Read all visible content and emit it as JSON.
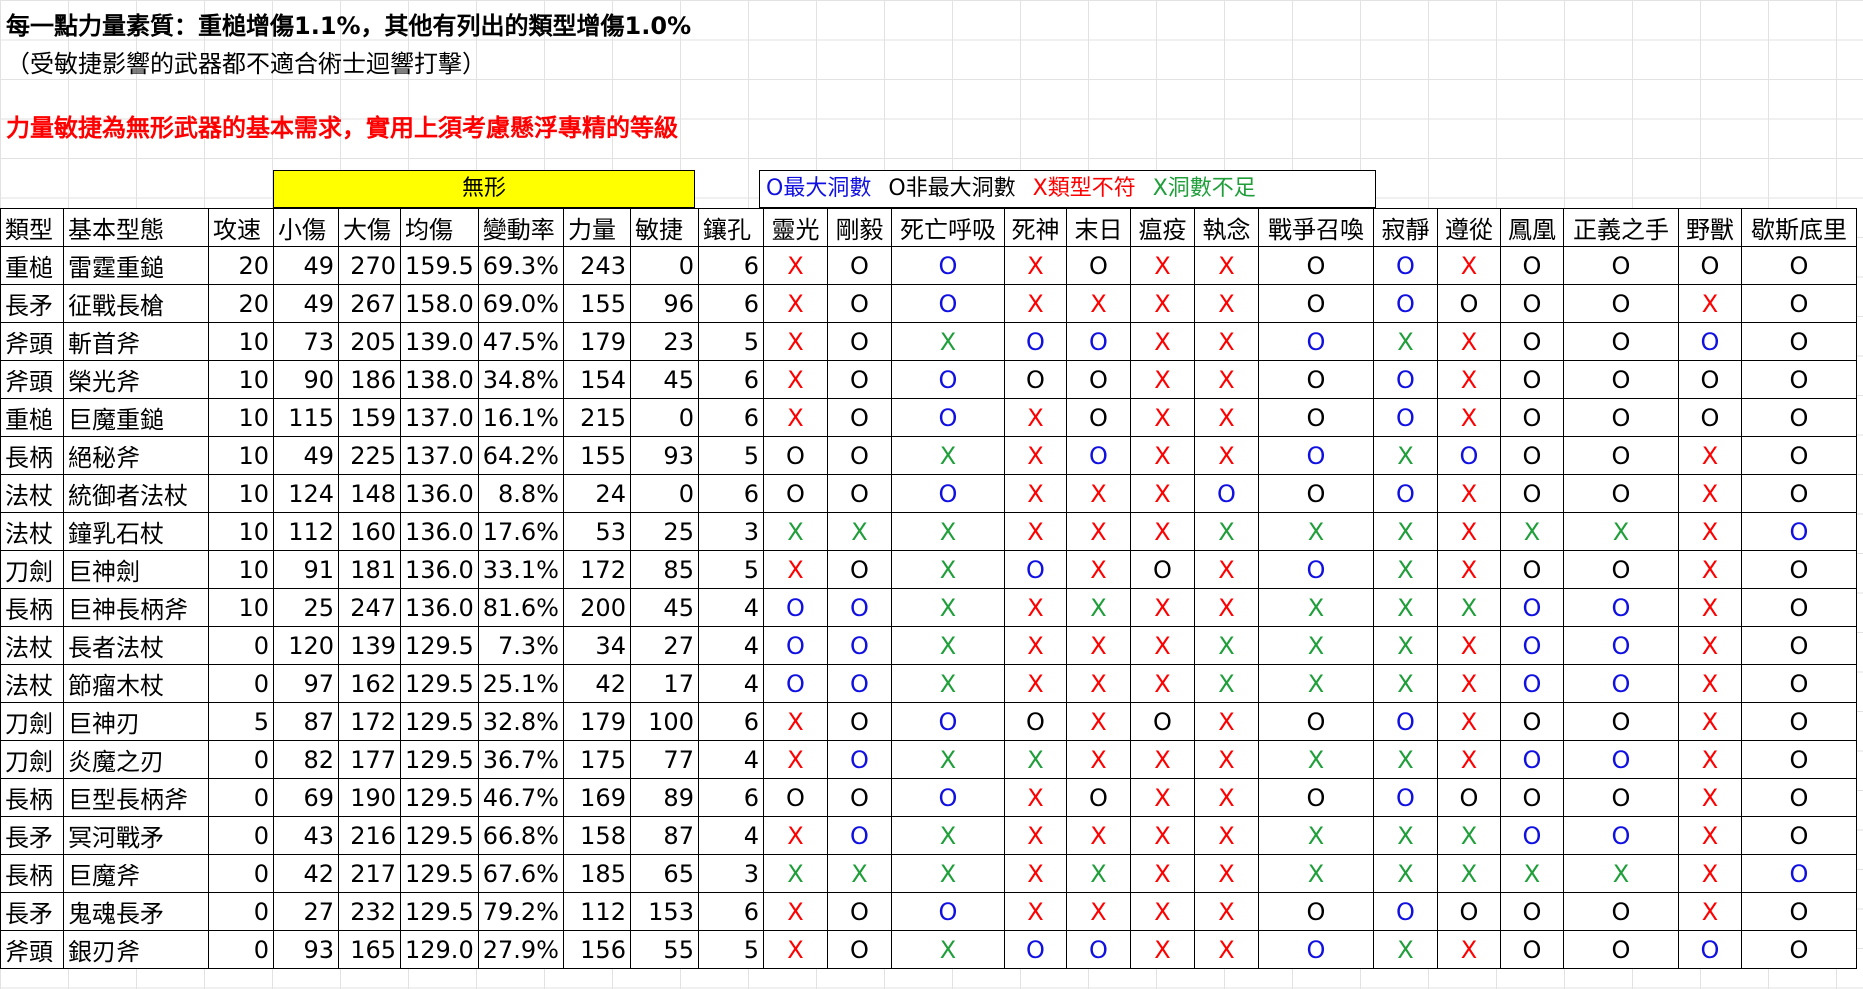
{
  "notes": {
    "line1": "每一點力量素質：重槌增傷1.1%，其他有列出的類型增傷1.0%",
    "line2": "（受敏捷影響的武器都不適合術士迴響打擊）",
    "line3": "力量敏捷為無形武器的基本需求，實用上須考慮懸浮專精的等級"
  },
  "group_header": "無形",
  "legend": {
    "max_holes": "O最大洞數",
    "not_max_holes": "O非最大洞數",
    "type_mismatch": "X類型不符",
    "not_enough_holes": "X洞數不足"
  },
  "colors": {
    "O": "#1010e0",
    "o": "#000000",
    "X": "#ff0000",
    "x": "#1f9e3a",
    "highlight": "#ffff00"
  },
  "columns": [
    "類型",
    "基本型態",
    "攻速",
    "小傷",
    "大傷",
    "均傷",
    "變動率",
    "力量",
    "敏捷",
    "鑲孔",
    "靈光",
    "剛毅",
    "死亡呼吸",
    "死神",
    "末日",
    "瘟疫",
    "執念",
    "戰爭召喚",
    "寂靜",
    "遵從",
    "鳳凰",
    "正義之手",
    "野獸",
    "歇斯底里"
  ],
  "rows": [
    {
      "type": "重槌",
      "name": "雷霆重鎚",
      "speed": "20",
      "min": "49",
      "max": "270",
      "avg": "159.5",
      "var": "69.3%",
      "str": "243",
      "dex": "0",
      "sockets": "6",
      "marks": [
        "X",
        "o",
        "O",
        "X",
        "o",
        "X",
        "X",
        "o",
        "O",
        "X",
        "o",
        "o",
        "o",
        "o"
      ]
    },
    {
      "type": "長矛",
      "name": "征戰長槍",
      "speed": "20",
      "min": "49",
      "max": "267",
      "avg": "158.0",
      "var": "69.0%",
      "str": "155",
      "dex": "96",
      "sockets": "6",
      "marks": [
        "X",
        "o",
        "O",
        "X",
        "X",
        "X",
        "X",
        "o",
        "O",
        "o",
        "o",
        "o",
        "X",
        "o"
      ]
    },
    {
      "type": "斧頭",
      "name": "斬首斧",
      "speed": "10",
      "min": "73",
      "max": "205",
      "avg": "139.0",
      "var": "47.5%",
      "str": "179",
      "dex": "23",
      "sockets": "5",
      "marks": [
        "X",
        "o",
        "x",
        "O",
        "O",
        "X",
        "X",
        "O",
        "x",
        "X",
        "o",
        "o",
        "O",
        "o"
      ]
    },
    {
      "type": "斧頭",
      "name": "榮光斧",
      "speed": "10",
      "min": "90",
      "max": "186",
      "avg": "138.0",
      "var": "34.8%",
      "str": "154",
      "dex": "45",
      "sockets": "6",
      "marks": [
        "X",
        "o",
        "O",
        "o",
        "o",
        "X",
        "X",
        "o",
        "O",
        "X",
        "o",
        "o",
        "o",
        "o"
      ]
    },
    {
      "type": "重槌",
      "name": "巨魔重鎚",
      "speed": "10",
      "min": "115",
      "max": "159",
      "avg": "137.0",
      "var": "16.1%",
      "str": "215",
      "dex": "0",
      "sockets": "6",
      "marks": [
        "X",
        "o",
        "O",
        "X",
        "o",
        "X",
        "X",
        "o",
        "O",
        "X",
        "o",
        "o",
        "o",
        "o"
      ]
    },
    {
      "type": "長柄",
      "name": "絕秘斧",
      "speed": "10",
      "min": "49",
      "max": "225",
      "avg": "137.0",
      "var": "64.2%",
      "str": "155",
      "dex": "93",
      "sockets": "5",
      "marks": [
        "o",
        "o",
        "x",
        "X",
        "O",
        "X",
        "X",
        "O",
        "x",
        "O",
        "o",
        "o",
        "X",
        "o"
      ]
    },
    {
      "type": "法杖",
      "name": "統御者法杖",
      "speed": "10",
      "min": "124",
      "max": "148",
      "avg": "136.0",
      "var": "8.8%",
      "str": "24",
      "dex": "0",
      "sockets": "6",
      "marks": [
        "o",
        "o",
        "O",
        "X",
        "X",
        "X",
        "O",
        "o",
        "O",
        "X",
        "o",
        "o",
        "X",
        "o"
      ]
    },
    {
      "type": "法杖",
      "name": "鐘乳石杖",
      "speed": "10",
      "min": "112",
      "max": "160",
      "avg": "136.0",
      "var": "17.6%",
      "str": "53",
      "dex": "25",
      "sockets": "3",
      "marks": [
        "x",
        "x",
        "x",
        "X",
        "X",
        "X",
        "x",
        "x",
        "x",
        "X",
        "x",
        "x",
        "X",
        "O"
      ]
    },
    {
      "type": "刀劍",
      "name": "巨神劍",
      "speed": "10",
      "min": "91",
      "max": "181",
      "avg": "136.0",
      "var": "33.1%",
      "str": "172",
      "dex": "85",
      "sockets": "5",
      "marks": [
        "X",
        "o",
        "x",
        "O",
        "X",
        "o",
        "X",
        "O",
        "x",
        "X",
        "o",
        "o",
        "X",
        "o"
      ]
    },
    {
      "type": "長柄",
      "name": "巨神長柄斧",
      "speed": "10",
      "min": "25",
      "max": "247",
      "avg": "136.0",
      "var": "81.6%",
      "str": "200",
      "dex": "45",
      "sockets": "4",
      "marks": [
        "O",
        "O",
        "x",
        "X",
        "x",
        "X",
        "X",
        "x",
        "x",
        "x",
        "O",
        "O",
        "X",
        "o"
      ]
    },
    {
      "type": "法杖",
      "name": "長者法杖",
      "speed": "0",
      "min": "120",
      "max": "139",
      "avg": "129.5",
      "var": "7.3%",
      "str": "34",
      "dex": "27",
      "sockets": "4",
      "marks": [
        "O",
        "O",
        "x",
        "X",
        "X",
        "X",
        "x",
        "x",
        "x",
        "X",
        "O",
        "O",
        "X",
        "o"
      ]
    },
    {
      "type": "法杖",
      "name": "節瘤木杖",
      "speed": "0",
      "min": "97",
      "max": "162",
      "avg": "129.5",
      "var": "25.1%",
      "str": "42",
      "dex": "17",
      "sockets": "4",
      "marks": [
        "O",
        "O",
        "x",
        "X",
        "X",
        "X",
        "x",
        "x",
        "x",
        "X",
        "O",
        "O",
        "X",
        "o"
      ]
    },
    {
      "type": "刀劍",
      "name": "巨神刃",
      "speed": "5",
      "min": "87",
      "max": "172",
      "avg": "129.5",
      "var": "32.8%",
      "str": "179",
      "dex": "100",
      "sockets": "6",
      "marks": [
        "X",
        "o",
        "O",
        "o",
        "X",
        "o",
        "X",
        "o",
        "O",
        "X",
        "o",
        "o",
        "X",
        "o"
      ]
    },
    {
      "type": "刀劍",
      "name": "炎魔之刃",
      "speed": "0",
      "min": "82",
      "max": "177",
      "avg": "129.5",
      "var": "36.7%",
      "str": "175",
      "dex": "77",
      "sockets": "4",
      "marks": [
        "X",
        "O",
        "x",
        "x",
        "X",
        "X",
        "X",
        "x",
        "x",
        "X",
        "O",
        "O",
        "X",
        "o"
      ]
    },
    {
      "type": "長柄",
      "name": "巨型長柄斧",
      "speed": "0",
      "min": "69",
      "max": "190",
      "avg": "129.5",
      "var": "46.7%",
      "str": "169",
      "dex": "89",
      "sockets": "6",
      "marks": [
        "o",
        "o",
        "O",
        "X",
        "o",
        "X",
        "X",
        "o",
        "O",
        "o",
        "o",
        "o",
        "X",
        "o"
      ]
    },
    {
      "type": "長矛",
      "name": "冥河戰矛",
      "speed": "0",
      "min": "43",
      "max": "216",
      "avg": "129.5",
      "var": "66.8%",
      "str": "158",
      "dex": "87",
      "sockets": "4",
      "marks": [
        "X",
        "O",
        "x",
        "X",
        "X",
        "X",
        "X",
        "x",
        "x",
        "x",
        "O",
        "O",
        "X",
        "o"
      ]
    },
    {
      "type": "長柄",
      "name": "巨魔斧",
      "speed": "0",
      "min": "42",
      "max": "217",
      "avg": "129.5",
      "var": "67.6%",
      "str": "185",
      "dex": "65",
      "sockets": "3",
      "marks": [
        "x",
        "x",
        "x",
        "X",
        "x",
        "X",
        "X",
        "x",
        "x",
        "x",
        "x",
        "x",
        "X",
        "O"
      ]
    },
    {
      "type": "長矛",
      "name": "鬼魂長矛",
      "speed": "0",
      "min": "27",
      "max": "232",
      "avg": "129.5",
      "var": "79.2%",
      "str": "112",
      "dex": "153",
      "sockets": "6",
      "marks": [
        "X",
        "o",
        "O",
        "X",
        "X",
        "X",
        "X",
        "o",
        "O",
        "o",
        "o",
        "o",
        "X",
        "o"
      ]
    },
    {
      "type": "斧頭",
      "name": "銀刃斧",
      "speed": "0",
      "min": "93",
      "max": "165",
      "avg": "129.0",
      "var": "27.9%",
      "str": "156",
      "dex": "55",
      "sockets": "5",
      "marks": [
        "X",
        "o",
        "x",
        "O",
        "O",
        "X",
        "X",
        "O",
        "x",
        "X",
        "o",
        "o",
        "O",
        "o"
      ]
    }
  ]
}
